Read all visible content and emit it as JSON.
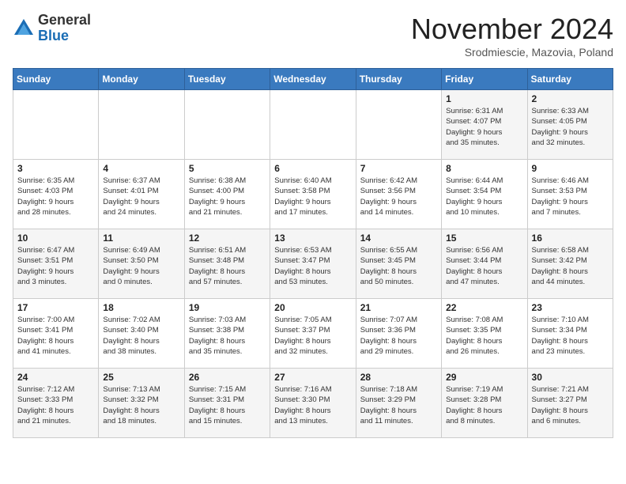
{
  "header": {
    "logo_line1": "General",
    "logo_line2": "Blue",
    "title": "November 2024",
    "subtitle": "Srodmiescie, Mazovia, Poland"
  },
  "weekdays": [
    "Sunday",
    "Monday",
    "Tuesday",
    "Wednesday",
    "Thursday",
    "Friday",
    "Saturday"
  ],
  "weeks": [
    [
      {
        "day": "",
        "info": ""
      },
      {
        "day": "",
        "info": ""
      },
      {
        "day": "",
        "info": ""
      },
      {
        "day": "",
        "info": ""
      },
      {
        "day": "",
        "info": ""
      },
      {
        "day": "1",
        "info": "Sunrise: 6:31 AM\nSunset: 4:07 PM\nDaylight: 9 hours\nand 35 minutes."
      },
      {
        "day": "2",
        "info": "Sunrise: 6:33 AM\nSunset: 4:05 PM\nDaylight: 9 hours\nand 32 minutes."
      }
    ],
    [
      {
        "day": "3",
        "info": "Sunrise: 6:35 AM\nSunset: 4:03 PM\nDaylight: 9 hours\nand 28 minutes."
      },
      {
        "day": "4",
        "info": "Sunrise: 6:37 AM\nSunset: 4:01 PM\nDaylight: 9 hours\nand 24 minutes."
      },
      {
        "day": "5",
        "info": "Sunrise: 6:38 AM\nSunset: 4:00 PM\nDaylight: 9 hours\nand 21 minutes."
      },
      {
        "day": "6",
        "info": "Sunrise: 6:40 AM\nSunset: 3:58 PM\nDaylight: 9 hours\nand 17 minutes."
      },
      {
        "day": "7",
        "info": "Sunrise: 6:42 AM\nSunset: 3:56 PM\nDaylight: 9 hours\nand 14 minutes."
      },
      {
        "day": "8",
        "info": "Sunrise: 6:44 AM\nSunset: 3:54 PM\nDaylight: 9 hours\nand 10 minutes."
      },
      {
        "day": "9",
        "info": "Sunrise: 6:46 AM\nSunset: 3:53 PM\nDaylight: 9 hours\nand 7 minutes."
      }
    ],
    [
      {
        "day": "10",
        "info": "Sunrise: 6:47 AM\nSunset: 3:51 PM\nDaylight: 9 hours\nand 3 minutes."
      },
      {
        "day": "11",
        "info": "Sunrise: 6:49 AM\nSunset: 3:50 PM\nDaylight: 9 hours\nand 0 minutes."
      },
      {
        "day": "12",
        "info": "Sunrise: 6:51 AM\nSunset: 3:48 PM\nDaylight: 8 hours\nand 57 minutes."
      },
      {
        "day": "13",
        "info": "Sunrise: 6:53 AM\nSunset: 3:47 PM\nDaylight: 8 hours\nand 53 minutes."
      },
      {
        "day": "14",
        "info": "Sunrise: 6:55 AM\nSunset: 3:45 PM\nDaylight: 8 hours\nand 50 minutes."
      },
      {
        "day": "15",
        "info": "Sunrise: 6:56 AM\nSunset: 3:44 PM\nDaylight: 8 hours\nand 47 minutes."
      },
      {
        "day": "16",
        "info": "Sunrise: 6:58 AM\nSunset: 3:42 PM\nDaylight: 8 hours\nand 44 minutes."
      }
    ],
    [
      {
        "day": "17",
        "info": "Sunrise: 7:00 AM\nSunset: 3:41 PM\nDaylight: 8 hours\nand 41 minutes."
      },
      {
        "day": "18",
        "info": "Sunrise: 7:02 AM\nSunset: 3:40 PM\nDaylight: 8 hours\nand 38 minutes."
      },
      {
        "day": "19",
        "info": "Sunrise: 7:03 AM\nSunset: 3:38 PM\nDaylight: 8 hours\nand 35 minutes."
      },
      {
        "day": "20",
        "info": "Sunrise: 7:05 AM\nSunset: 3:37 PM\nDaylight: 8 hours\nand 32 minutes."
      },
      {
        "day": "21",
        "info": "Sunrise: 7:07 AM\nSunset: 3:36 PM\nDaylight: 8 hours\nand 29 minutes."
      },
      {
        "day": "22",
        "info": "Sunrise: 7:08 AM\nSunset: 3:35 PM\nDaylight: 8 hours\nand 26 minutes."
      },
      {
        "day": "23",
        "info": "Sunrise: 7:10 AM\nSunset: 3:34 PM\nDaylight: 8 hours\nand 23 minutes."
      }
    ],
    [
      {
        "day": "24",
        "info": "Sunrise: 7:12 AM\nSunset: 3:33 PM\nDaylight: 8 hours\nand 21 minutes."
      },
      {
        "day": "25",
        "info": "Sunrise: 7:13 AM\nSunset: 3:32 PM\nDaylight: 8 hours\nand 18 minutes."
      },
      {
        "day": "26",
        "info": "Sunrise: 7:15 AM\nSunset: 3:31 PM\nDaylight: 8 hours\nand 15 minutes."
      },
      {
        "day": "27",
        "info": "Sunrise: 7:16 AM\nSunset: 3:30 PM\nDaylight: 8 hours\nand 13 minutes."
      },
      {
        "day": "28",
        "info": "Sunrise: 7:18 AM\nSunset: 3:29 PM\nDaylight: 8 hours\nand 11 minutes."
      },
      {
        "day": "29",
        "info": "Sunrise: 7:19 AM\nSunset: 3:28 PM\nDaylight: 8 hours\nand 8 minutes."
      },
      {
        "day": "30",
        "info": "Sunrise: 7:21 AM\nSunset: 3:27 PM\nDaylight: 8 hours\nand 6 minutes."
      }
    ]
  ]
}
